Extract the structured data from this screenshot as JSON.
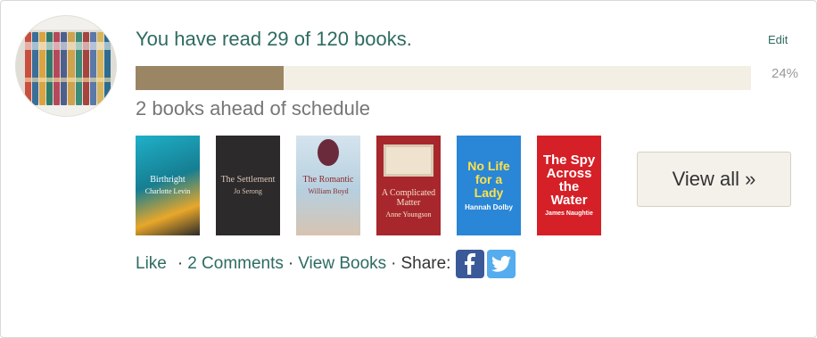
{
  "challenge": {
    "headline": "You have read 29 of 120 books.",
    "edit_label": "Edit",
    "progress_fraction": 0.24,
    "progress_percent_label": "24%",
    "schedule_text": "2 books ahead of schedule"
  },
  "avatar": {
    "spine_colors": [
      "#c94e3f",
      "#3a6f9a",
      "#d9a441",
      "#2f7c6b",
      "#b5485a",
      "#4d5f8c",
      "#cfa34e",
      "#3d8c7a",
      "#a6443e",
      "#5a78a8",
      "#d8b45a",
      "#2e6d8e"
    ]
  },
  "books": [
    {
      "title": "Birthright",
      "author": "Charlotte Levin",
      "icon": "book-cover-image"
    },
    {
      "title": "The Settlement",
      "author": "Jo Serong",
      "icon": "book-cover-image"
    },
    {
      "title": "The Romantic",
      "author": "William Boyd",
      "icon": "book-cover-image"
    },
    {
      "title": "A Complicated Matter",
      "author": "Anne Youngson",
      "icon": "book-cover-image"
    },
    {
      "title": "No Life for a Lady",
      "author": "Hannah Dolby",
      "icon": "book-cover-image"
    },
    {
      "title": "The Spy Across the Water",
      "author": "James Naughtie",
      "icon": "book-cover-image"
    }
  ],
  "view_all_label": "View all »",
  "actions": {
    "like_label": "Like",
    "comments_label": "2 Comments",
    "view_books_label": "View Books",
    "share_label": "Share:",
    "separator": "·"
  },
  "social": {
    "facebook": {
      "icon": "facebook-icon",
      "color": "#3b5998"
    },
    "twitter": {
      "icon": "twitter-icon",
      "color": "#55acee"
    }
  },
  "colors": {
    "link": "#2e6b62",
    "progress_fill": "#9a8665",
    "progress_track": "#f3efe5",
    "muted_text": "#767676"
  }
}
